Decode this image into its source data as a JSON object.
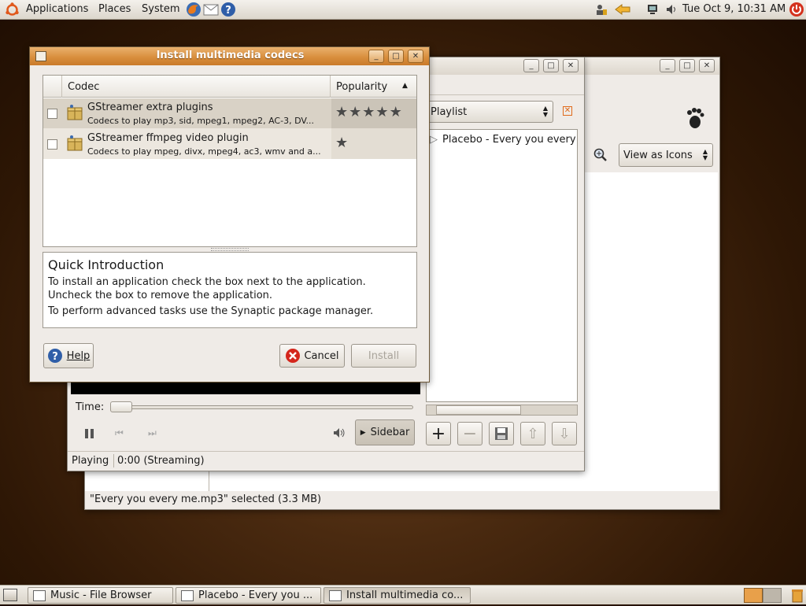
{
  "top_panel": {
    "menus": [
      "Applications",
      "Places",
      "System"
    ],
    "clock": "Tue Oct  9, 10:31 AM"
  },
  "bottom_panel": {
    "tasks": [
      "Music - File Browser",
      "Placebo - Every you ...",
      "Install multimedia co..."
    ]
  },
  "file_browser": {
    "view_select": "View as Icons",
    "status": "\"Every you every me.mp3\" selected (3.3 MB)"
  },
  "player": {
    "playlist_select": "Playlist",
    "playlist_items": [
      "Placebo - Every you every me"
    ],
    "time_label": "Time:",
    "sidebar_label": "Sidebar",
    "status_playing": "Playing",
    "status_time": "0:00 (Streaming)"
  },
  "dialog": {
    "title": "Install multimedia codecs",
    "col_codec": "Codec",
    "col_popularity": "Popularity",
    "codecs": [
      {
        "name": "GStreamer extra plugins",
        "desc": "Codecs to play mp3, sid, mpeg1, mpeg2, AC-3, DV...",
        "stars": 5
      },
      {
        "name": "GStreamer ffmpeg video plugin",
        "desc": "Codecs to play mpeg, divx, mpeg4, ac3, wmv and a...",
        "stars": 1
      }
    ],
    "intro_title": "Quick Introduction",
    "intro_p1": "To install an application check the box next to the application. Uncheck the box to remove the application.",
    "intro_p2": "To perform advanced tasks use the Synaptic package manager.",
    "help_label": "Help",
    "cancel_label": "Cancel",
    "install_label": "Install"
  },
  "colors": {
    "dialog_title_bg": "#d98f3e",
    "accent": "#e06a1b"
  }
}
